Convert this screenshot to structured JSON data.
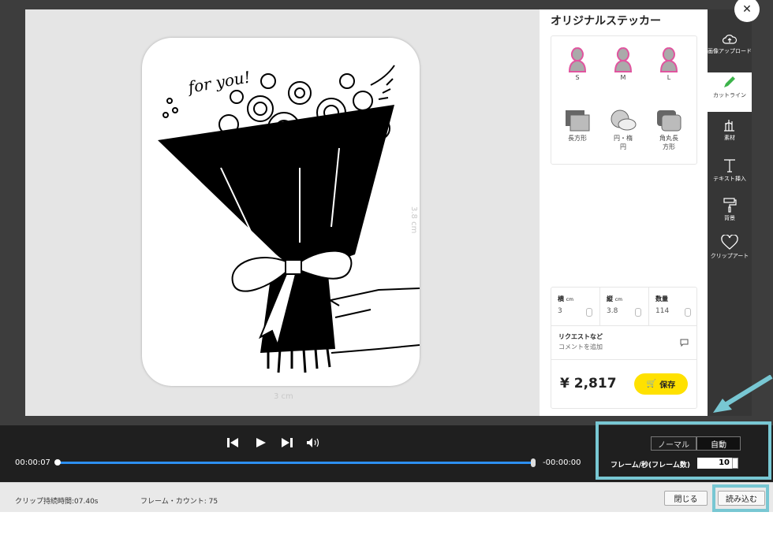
{
  "canvas": {
    "dim_width": "3 cm",
    "dim_height": "3.8 cm",
    "sticker_text": "for you!"
  },
  "panel": {
    "title": "オリジナルステッカー",
    "sizes": [
      "S",
      "M",
      "L"
    ],
    "shapes": [
      {
        "label": "長方形",
        "icon": "rectangle-icon"
      },
      {
        "label": "円・楕円",
        "icon": "circle-icon"
      },
      {
        "label": "角丸長方形",
        "icon": "rounded-rect-icon"
      }
    ],
    "fields": [
      {
        "label": "横",
        "unit": "cm",
        "value": "3"
      },
      {
        "label": "縦",
        "unit": "cm",
        "value": "3.8"
      },
      {
        "label": "数量",
        "unit": "",
        "value": "114"
      }
    ],
    "request_title": "リクエストなど",
    "request_placeholder": "コメントを追加",
    "price": "¥ 2,817",
    "save_label": "保存"
  },
  "toolbar": {
    "tools": [
      {
        "label": "画像アップロード",
        "icon": "cloud-upload-icon"
      },
      {
        "label": "カットライン",
        "icon": "pencil-icon"
      },
      {
        "label": "素材",
        "icon": "material-icon"
      },
      {
        "label": "テキスト挿入",
        "icon": "text-icon"
      },
      {
        "label": "背景",
        "icon": "paint-roller-icon"
      },
      {
        "label": "クリップアート",
        "icon": "heart-icon"
      }
    ]
  },
  "playback": {
    "current_time": "00:00:07",
    "remaining_time": "-00:00:00",
    "mode_normal": "ノーマル",
    "mode_auto": "自動",
    "fps_label": "フレーム/秒(フレーム数)",
    "fps_value": "10",
    "progress": 1.0
  },
  "footer": {
    "clip_duration": "クリップ持続時間:07.40s",
    "frame_count": "フレーム・カウント: 75",
    "close_label": "閉じる",
    "load_label": "読み込む"
  },
  "colors": {
    "accent_blue": "#2d8ff0",
    "highlight": "#78c7d3",
    "save_yellow": "#ffe100"
  }
}
